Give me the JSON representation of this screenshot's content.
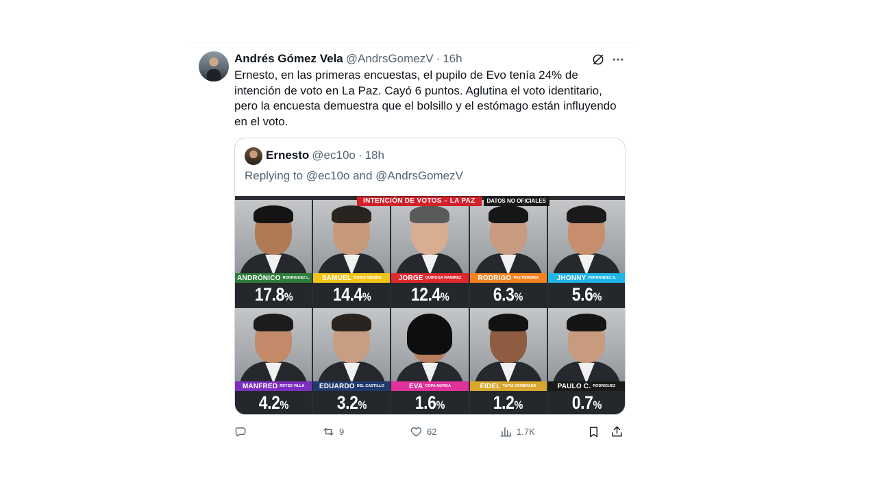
{
  "tweet": {
    "author_name": "Andrés Gómez Vela",
    "author_handle": "@AndrsGomezV",
    "separator": "·",
    "time": "16h",
    "text": "Ernesto, en las primeras encuestas, el pupilo de Evo tenía 24% de intención de voto en La Paz. Cayó 6 puntos. Aglutina el voto identitario, pero la encuesta demuestra que el bolsillo y el estómago están influyendo en el voto.",
    "icons": {
      "grok": "grok-icon",
      "more": "more-horizontal-icon"
    }
  },
  "quote": {
    "author_name": "Ernesto",
    "author_handle": "@ec10o",
    "separator": "·",
    "time": "18h",
    "reply_context": "Replying to @ec10o and @AndrsGomezV",
    "image": {
      "banner_title": "INTENCIÓN DE VOTOS – LA PAZ",
      "banner_note": "DATOS NO OFICIALES",
      "candidates": [
        {
          "first": "ANDRÓNICO",
          "last": "RODRIGUEZ L.",
          "value": "17.8",
          "unit": "%",
          "color": "#2e7d3a"
        },
        {
          "first": "SAMUEL",
          "last": "DORIA MEDINA",
          "value": "14.4",
          "unit": "%",
          "color": "#f0c419"
        },
        {
          "first": "JORGE",
          "last": "QUIROGA RAMIREZ",
          "value": "12.4",
          "unit": "%",
          "color": "#e0282f"
        },
        {
          "first": "RODRIGO",
          "last": "PAZ PEREIRA",
          "value": "6.3",
          "unit": "%",
          "color": "#f58220"
        },
        {
          "first": "JHONNY",
          "last": "FERNANDEZ S.",
          "value": "5.6",
          "unit": "%",
          "color": "#1fb5e8"
        },
        {
          "first": "MANFRED",
          "last": "REYES VILLA",
          "value": "4.2",
          "unit": "%",
          "color": "#7b2fbf"
        },
        {
          "first": "EDUARDO",
          "last": "DEL CASTILLO",
          "value": "3.2",
          "unit": "%",
          "color": "#1f3a6e"
        },
        {
          "first": "EVA",
          "last": "COPA MURGA",
          "value": "1.6",
          "unit": "%",
          "color": "#e0329b"
        },
        {
          "first": "FIDEL",
          "last": "TAPIA ZAMBRANA",
          "value": "1.2",
          "unit": "%",
          "color": "#d9a62e"
        },
        {
          "first": "PAULO C.",
          "last": "RODRIGUEZ",
          "value": "0.7",
          "unit": "%",
          "color": "#1a1a1a"
        }
      ]
    }
  },
  "actions": {
    "reply_count": "",
    "retweet_count": "9",
    "like_count": "62",
    "views_count": "1.7K",
    "icons": [
      "reply-icon",
      "retweet-icon",
      "like-icon",
      "views-icon",
      "bookmark-icon",
      "share-icon"
    ]
  }
}
